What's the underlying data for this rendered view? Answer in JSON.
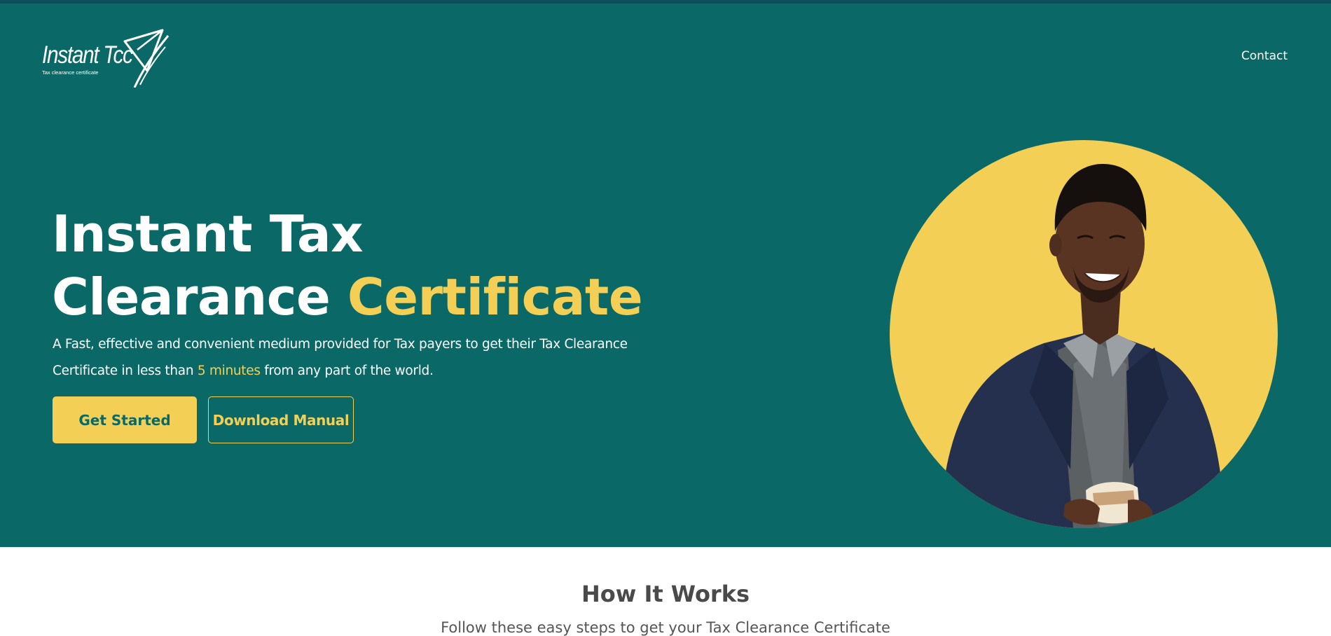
{
  "colors": {
    "hero_background": "#0a6966",
    "accent_yellow": "#f3cf56",
    "top_strip": "#0b4d5a",
    "heading_gray": "#4a4a4a"
  },
  "header": {
    "logo": {
      "title": "Instant Tcc",
      "tagline": "Tax clearance certificate",
      "icon": "paper-plane-swoosh-icon"
    },
    "nav": {
      "contact_label": "Contact"
    }
  },
  "hero": {
    "headline_line1": "Instant Tax",
    "headline_line2_plain": "Clearance ",
    "headline_line2_accent": "Certificate",
    "description_part1": "A Fast, effective and convenient medium provided for Tax payers to get their Tax Clearance Certificate in less than ",
    "description_highlight": "5 minutes",
    "description_part2": " from any part of the world.",
    "primary_button_label": "Get Started",
    "secondary_button_label": "Download Manual",
    "image": "smiling-man-in-suit-holding-money-photo"
  },
  "how_it_works": {
    "title": "How It Works",
    "subtitle": "Follow these easy steps to get your Tax Clearance Certificate"
  }
}
